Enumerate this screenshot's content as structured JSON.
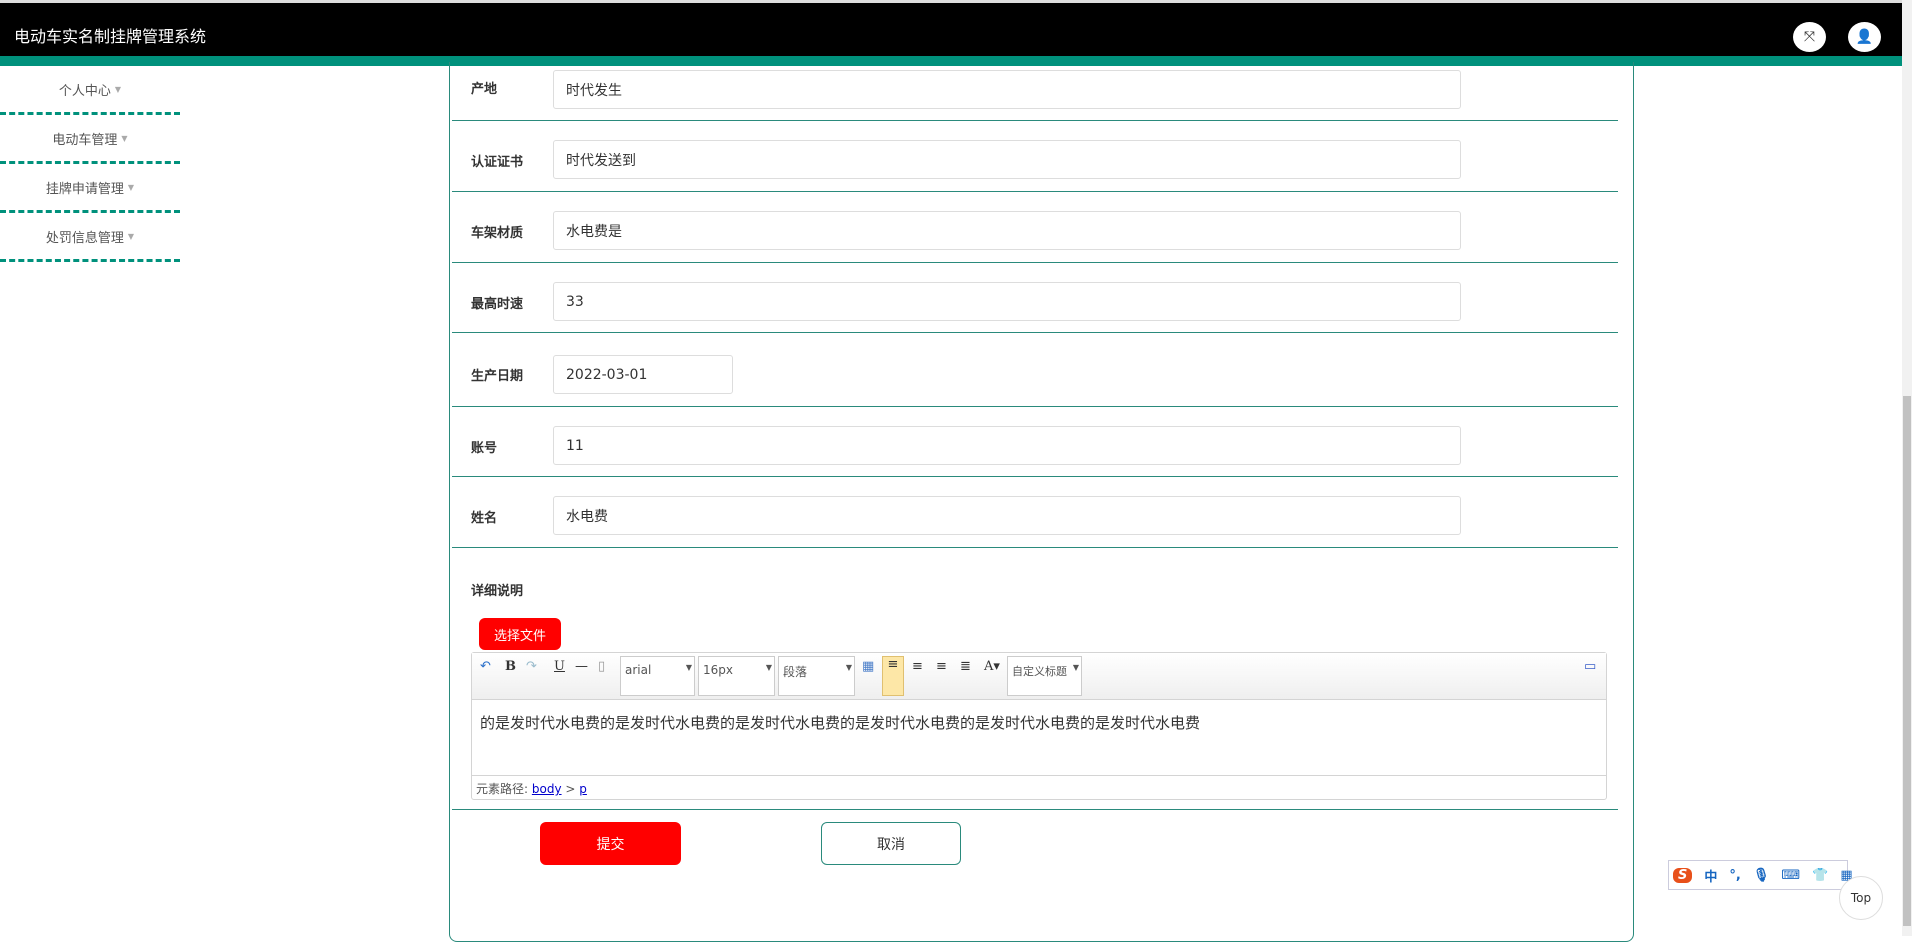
{
  "header": {
    "title": "电动车实名制挂牌管理系统"
  },
  "sidebar": {
    "items": [
      {
        "label": "个人中心"
      },
      {
        "label": "电动车管理"
      },
      {
        "label": "挂牌申请管理"
      },
      {
        "label": "处罚信息管理"
      }
    ]
  },
  "form": {
    "fields": [
      {
        "label": "产地",
        "value": "时代发生"
      },
      {
        "label": "认证证书",
        "value": "时代发送到"
      },
      {
        "label": "车架材质",
        "value": "水电费是"
      },
      {
        "label": "最高时速",
        "value": "33"
      },
      {
        "label": "生产日期",
        "value": "2022-03-01"
      },
      {
        "label": "账号",
        "value": "11"
      },
      {
        "label": "姓名",
        "value": "水电费"
      }
    ],
    "detail_label": "详细说明",
    "choose_file": "选择文件",
    "editor": {
      "font": "arial",
      "size": "16px",
      "paragraph": "段落",
      "custom_title": "自定义标题",
      "content": "的是发时代水电费的是发时代水电费的是发时代水电费的是发时代水电费的是发时代水电费的是发时代水电费",
      "path_label": "元素路径:",
      "path_body": "body",
      "path_sep": ">",
      "path_p": "p"
    },
    "submit": "提交",
    "cancel": "取消"
  },
  "ime": {
    "logo": "S",
    "mode": "中",
    "punct": "°,"
  },
  "top_button": "Top",
  "colors": {
    "accent": "#00917c",
    "button": "#ff0000"
  }
}
